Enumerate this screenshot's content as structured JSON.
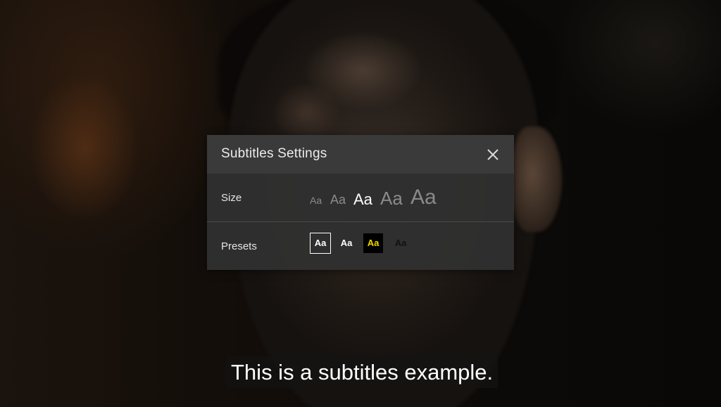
{
  "panel": {
    "title": "Subtitles Settings",
    "close_icon": "close-icon"
  },
  "size": {
    "label": "Size",
    "options": [
      "Aa",
      "Aa",
      "Aa",
      "Aa",
      "Aa"
    ],
    "selected_index": 2
  },
  "presets": {
    "label": "Presets",
    "options": [
      {
        "text": "Aa",
        "text_color": "#ffffff",
        "background": "transparent",
        "border": "#ffffff",
        "selected": true
      },
      {
        "text": "Aa",
        "text_color": "#ffffff",
        "background": "transparent",
        "border": "none",
        "selected": false
      },
      {
        "text": "Aa",
        "text_color": "#f0d800",
        "background": "#000000",
        "border": "none",
        "selected": false
      },
      {
        "text": "Aa",
        "text_color": "#111111",
        "background": "transparent",
        "border": "none",
        "selected": false
      }
    ]
  },
  "subtitle": {
    "text": "This is a subtitles example."
  },
  "colors": {
    "panel_bg": "#303030",
    "header_bg": "#3a3a3a",
    "text": "#ececec",
    "muted": "#8a8a8a"
  }
}
